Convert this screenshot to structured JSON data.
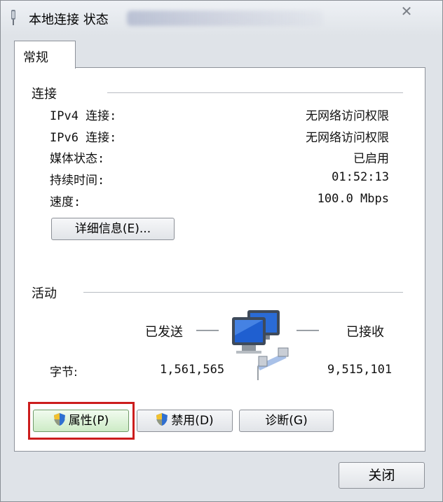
{
  "window": {
    "title": "本地连接 状态",
    "close_glyph": "✕"
  },
  "tabs": [
    {
      "label": "常规"
    }
  ],
  "connection": {
    "section_label": "连接",
    "rows": [
      {
        "label": "IPv4 连接:",
        "value": "无网络访问权限"
      },
      {
        "label": "IPv6 连接:",
        "value": "无网络访问权限"
      },
      {
        "label": "媒体状态:",
        "value": "已启用"
      },
      {
        "label": "持续时间:",
        "value": "01:52:13"
      },
      {
        "label": "速度:",
        "value": "100.0 Mbps"
      }
    ],
    "details_button": "详细信息(E)..."
  },
  "activity": {
    "section_label": "活动",
    "sent_label": "已发送",
    "received_label": "已接收",
    "bytes_label": "字节:",
    "bytes_sent": "1,561,565",
    "bytes_received": "9,515,101",
    "icon": "network-computers-icon"
  },
  "buttons": {
    "properties": "属性(P)",
    "disable": "禁用(D)",
    "diagnose": "诊断(G)",
    "close": "关闭"
  },
  "colors": {
    "highlight_border": "#cc1d1d",
    "shield_blue": "#2f6fd0",
    "shield_yellow": "#f2c12e"
  }
}
